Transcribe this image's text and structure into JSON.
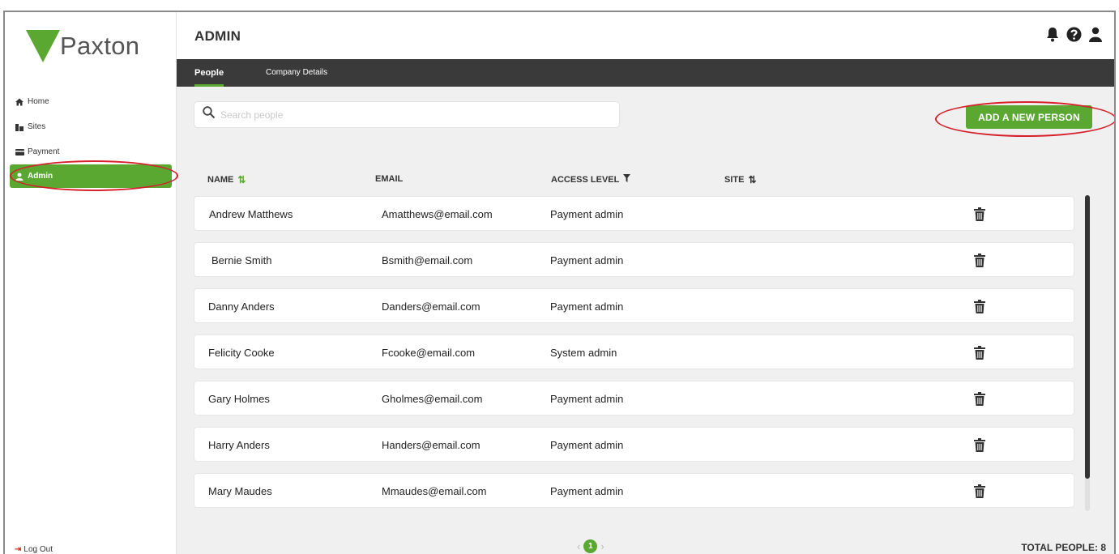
{
  "brand": {
    "name": "Paxton",
    "color": "#5aa832"
  },
  "sidebar": {
    "items": [
      {
        "label": "Home",
        "icon": "home-icon"
      },
      {
        "label": "Sites",
        "icon": "sites-icon"
      },
      {
        "label": "Payment",
        "icon": "payment-icon"
      },
      {
        "label": "Admin",
        "icon": "person-icon",
        "active": true
      }
    ],
    "logout_label": "Log Out"
  },
  "header": {
    "title": "ADMIN",
    "icons": [
      "bell-icon",
      "help-icon",
      "user-icon"
    ]
  },
  "tabs": [
    {
      "label": "People",
      "active": true
    },
    {
      "label": "Company Details",
      "active": false
    }
  ],
  "search": {
    "placeholder": "Search people",
    "value": ""
  },
  "add_button": {
    "label": "ADD A NEW PERSON"
  },
  "table": {
    "columns": [
      {
        "label": "NAME",
        "control": "sort"
      },
      {
        "label": "EMAIL",
        "control": ""
      },
      {
        "label": "ACCESS LEVEL",
        "control": "filter"
      },
      {
        "label": "SITE",
        "control": "sort"
      }
    ],
    "rows": [
      {
        "name": "Andrew Matthews",
        "email": "Amatthews@email.com",
        "access": "Payment admin",
        "site": ""
      },
      {
        "name": "Bernie Smith",
        "email": "Bsmith@email.com",
        "access": "Payment admin",
        "site": ""
      },
      {
        "name": "Danny Anders",
        "email": "Danders@email.com",
        "access": "Payment admin",
        "site": ""
      },
      {
        "name": "Felicity Cooke",
        "email": "Fcooke@email.com",
        "access": "System admin",
        "site": ""
      },
      {
        "name": "Gary Holmes",
        "email": "Gholmes@email.com",
        "access": "Payment admin",
        "site": ""
      },
      {
        "name": "Harry Anders",
        "email": "Handers@email.com",
        "access": "Payment admin",
        "site": ""
      },
      {
        "name": "Mary Maudes",
        "email": "Mmaudes@email.com",
        "access": "Payment admin",
        "site": ""
      }
    ]
  },
  "pagination": {
    "current_page": "1",
    "prev": "‹",
    "next": "›"
  },
  "total": "TOTAL PEOPLE: 8"
}
